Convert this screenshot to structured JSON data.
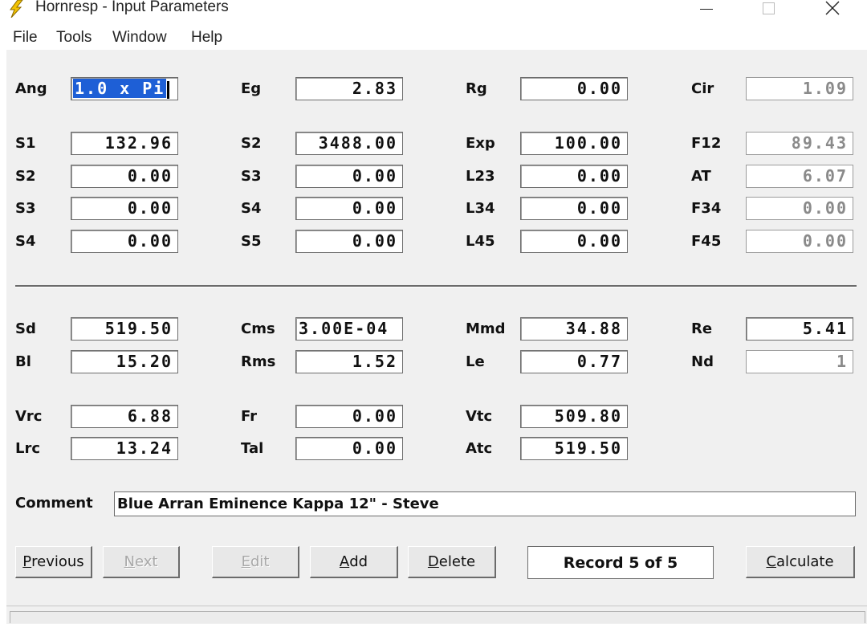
{
  "window": {
    "title": "Hornresp - Input Parameters",
    "controls": [
      "minimize",
      "maximize",
      "close"
    ]
  },
  "menu": [
    "File",
    "Tools",
    "Window",
    "Help"
  ],
  "params": {
    "ang": {
      "label": "Ang",
      "value": "1.0 x Pi"
    },
    "eg": {
      "label": "Eg",
      "value": "2.83"
    },
    "rg": {
      "label": "Rg",
      "value": "0.00"
    },
    "cir": {
      "label": "Cir",
      "value": "1.09"
    },
    "s1": {
      "label": "S1",
      "value": "132.96"
    },
    "s2b": {
      "label": "S2",
      "value": "3488.00"
    },
    "exp": {
      "label": "Exp",
      "value": "100.00"
    },
    "f12": {
      "label": "F12",
      "value": "89.43"
    },
    "s2": {
      "label": "S2",
      "value": "0.00"
    },
    "s3b": {
      "label": "S3",
      "value": "0.00"
    },
    "l23": {
      "label": "L23",
      "value": "0.00"
    },
    "at": {
      "label": "AT",
      "value": "6.07"
    },
    "s3": {
      "label": "S3",
      "value": "0.00"
    },
    "s4b": {
      "label": "S4",
      "value": "0.00"
    },
    "l34": {
      "label": "L34",
      "value": "0.00"
    },
    "f34": {
      "label": "F34",
      "value": "0.00"
    },
    "s4": {
      "label": "S4",
      "value": "0.00"
    },
    "s5": {
      "label": "S5",
      "value": "0.00"
    },
    "l45": {
      "label": "L45",
      "value": "0.00"
    },
    "f45": {
      "label": "F45",
      "value": "0.00"
    },
    "sd": {
      "label": "Sd",
      "value": "519.50"
    },
    "cms": {
      "label": "Cms",
      "value": "3.00E-04"
    },
    "mmd": {
      "label": "Mmd",
      "value": "34.88"
    },
    "re": {
      "label": "Re",
      "value": "5.41"
    },
    "bl": {
      "label": "Bl",
      "value": "15.20"
    },
    "rms": {
      "label": "Rms",
      "value": "1.52"
    },
    "le": {
      "label": "Le",
      "value": "0.77"
    },
    "nd": {
      "label": "Nd",
      "value": "1"
    },
    "vrc": {
      "label": "Vrc",
      "value": "6.88"
    },
    "fr": {
      "label": "Fr",
      "value": "0.00"
    },
    "vtc": {
      "label": "Vtc",
      "value": "509.80"
    },
    "lrc": {
      "label": "Lrc",
      "value": "13.24"
    },
    "tal": {
      "label": "Tal",
      "value": "0.00"
    },
    "atc": {
      "label": "Atc",
      "value": "519.50"
    }
  },
  "comment": {
    "label": "Comment",
    "value": "Blue Arran Eminence Kappa 12\" - Steve"
  },
  "buttons": {
    "previous": {
      "first": "P",
      "rest": "revious"
    },
    "next": {
      "first": "N",
      "rest": "ext"
    },
    "edit": {
      "first": "E",
      "rest": "dit"
    },
    "add": {
      "first": "A",
      "rest": "dd"
    },
    "delete": {
      "first": "D",
      "rest": "elete"
    },
    "calculate": {
      "first": "C",
      "rest": "alculate"
    }
  },
  "record": "Record 5 of 5",
  "colors": {
    "selection": "#1e5fd6",
    "face": "#f0f0f0",
    "readonly_text": "#8a8a8a",
    "app_icon": "#f2c200"
  }
}
